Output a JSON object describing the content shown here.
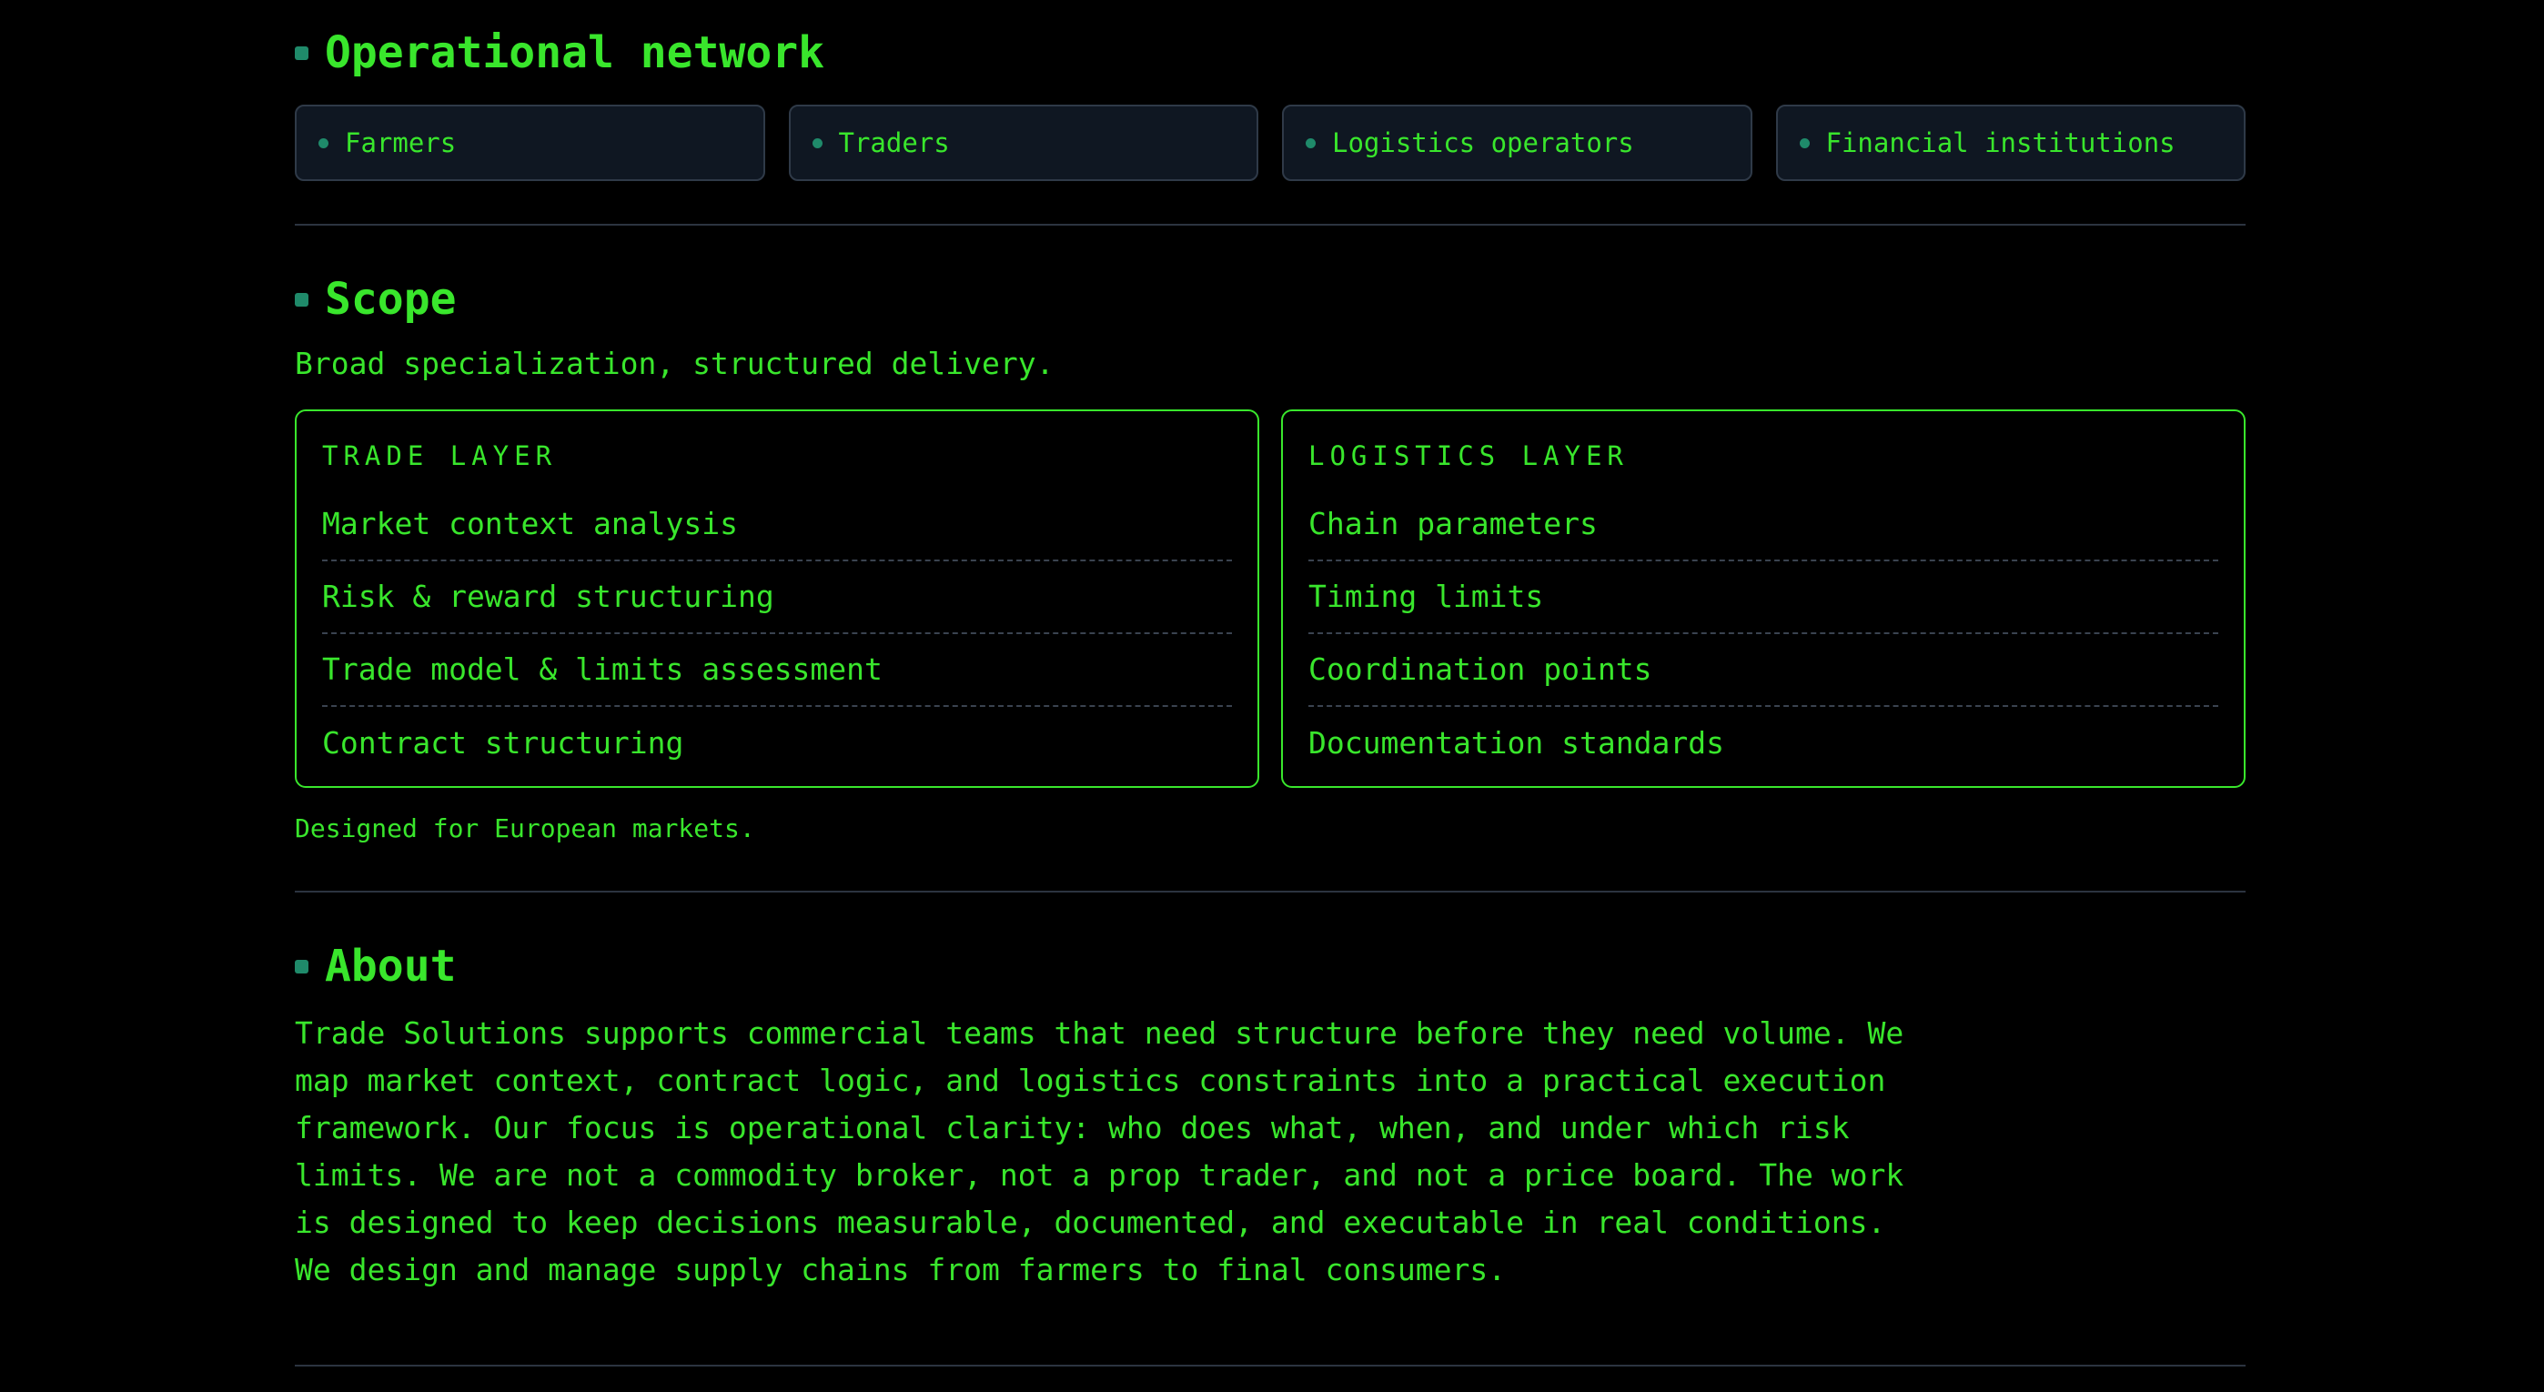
{
  "network": {
    "title": "Operational network",
    "items": [
      {
        "label": "Farmers"
      },
      {
        "label": "Traders"
      },
      {
        "label": "Logistics operators"
      },
      {
        "label": "Financial institutions"
      }
    ]
  },
  "scope": {
    "title": "Scope",
    "lead": "Broad specialization, structured delivery.",
    "trade": {
      "kicker": "TRADE LAYER",
      "items": [
        "Market context analysis",
        "Risk & reward structuring",
        "Trade model & limits assessment",
        "Contract structuring"
      ]
    },
    "logistics": {
      "kicker": "LOGISTICS LAYER",
      "items": [
        "Chain parameters",
        "Timing limits",
        "Coordination points",
        "Documentation standards"
      ]
    },
    "footnote": "Designed for European markets."
  },
  "about": {
    "title": "About",
    "body": "Trade Solutions supports commercial teams that need structure before they need volume. We map market context, contract logic, and logistics constraints into a practical execution framework. Our focus is operational clarity: who does what, when, and under which risk limits. We are not a commodity broker, not a prop trader, and not a price board. The work is designed to keep decisions measurable, documented, and executable in real conditions. We design and manage supply chains from farmers to final consumers."
  },
  "colors": {
    "background": "#000000",
    "accent": "#39e62c",
    "marker": "#1f8a6a",
    "card_bg": "#0f1722",
    "border": "#2f3a48"
  }
}
